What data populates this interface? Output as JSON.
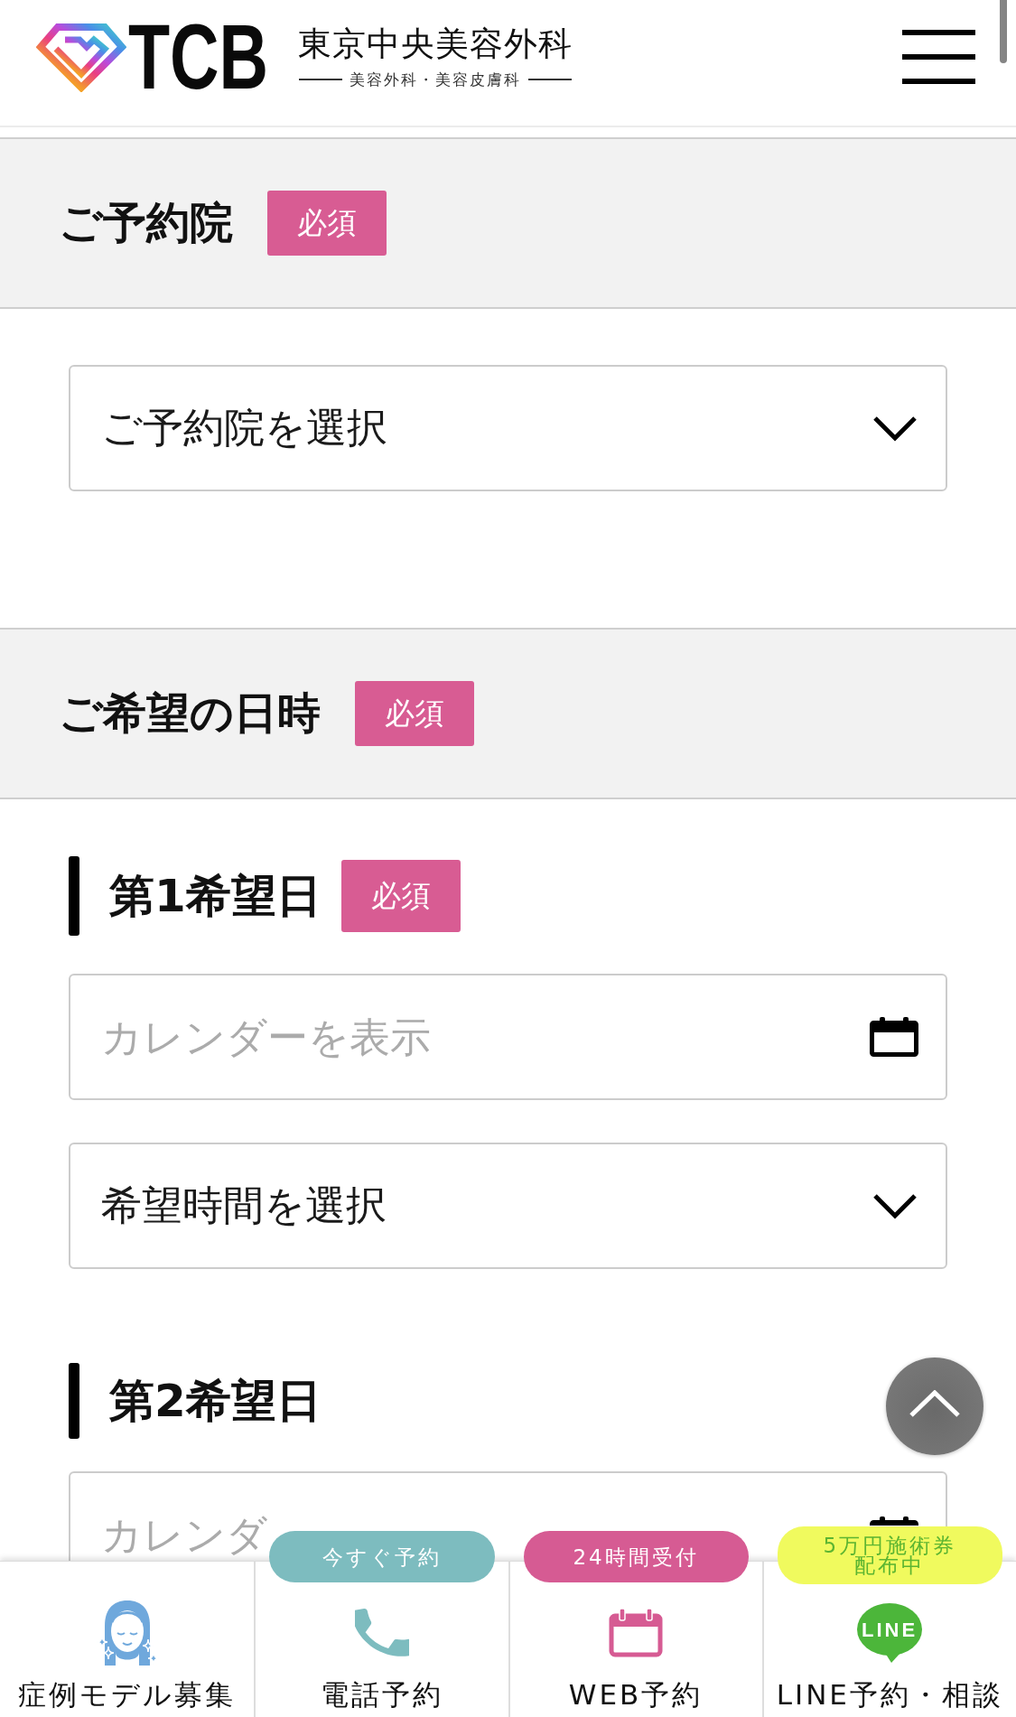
{
  "header": {
    "logo_text": "TCB",
    "clinic_name": "東京中央美容外科",
    "tagline": "美容外科・美容皮膚科"
  },
  "sections": [
    {
      "title": "ご予約院",
      "badge": "必須",
      "fields": [
        {
          "kind": "select",
          "value": "ご予約院を選択"
        }
      ]
    },
    {
      "title": "ご希望の日時",
      "badge": "必須",
      "groups": [
        {
          "title": "第1希望日",
          "badge": "必須",
          "fields": [
            {
              "kind": "date",
              "placeholder": "カレンダーを表示"
            },
            {
              "kind": "select",
              "value": "希望時間を選択"
            }
          ]
        },
        {
          "title": "第2希望日",
          "fields": [
            {
              "kind": "date",
              "placeholder": "カレンダ"
            }
          ]
        }
      ]
    }
  ],
  "bottom_nav": [
    {
      "kind": "model",
      "label": "症例モデル募集"
    },
    {
      "kind": "phone",
      "label": "電話予約",
      "badge": {
        "text": "今すぐ予約",
        "color": "#7dbcbf"
      }
    },
    {
      "kind": "web",
      "label": "WEB予約",
      "badge": {
        "text": "24時間受付",
        "color": "#d65b93"
      }
    },
    {
      "kind": "line",
      "label": "LINE予約・相談",
      "icon_text": "LINE",
      "badge": {
        "text": "5万円施術券配布中",
        "color": "#f0fa5e"
      }
    }
  ]
}
